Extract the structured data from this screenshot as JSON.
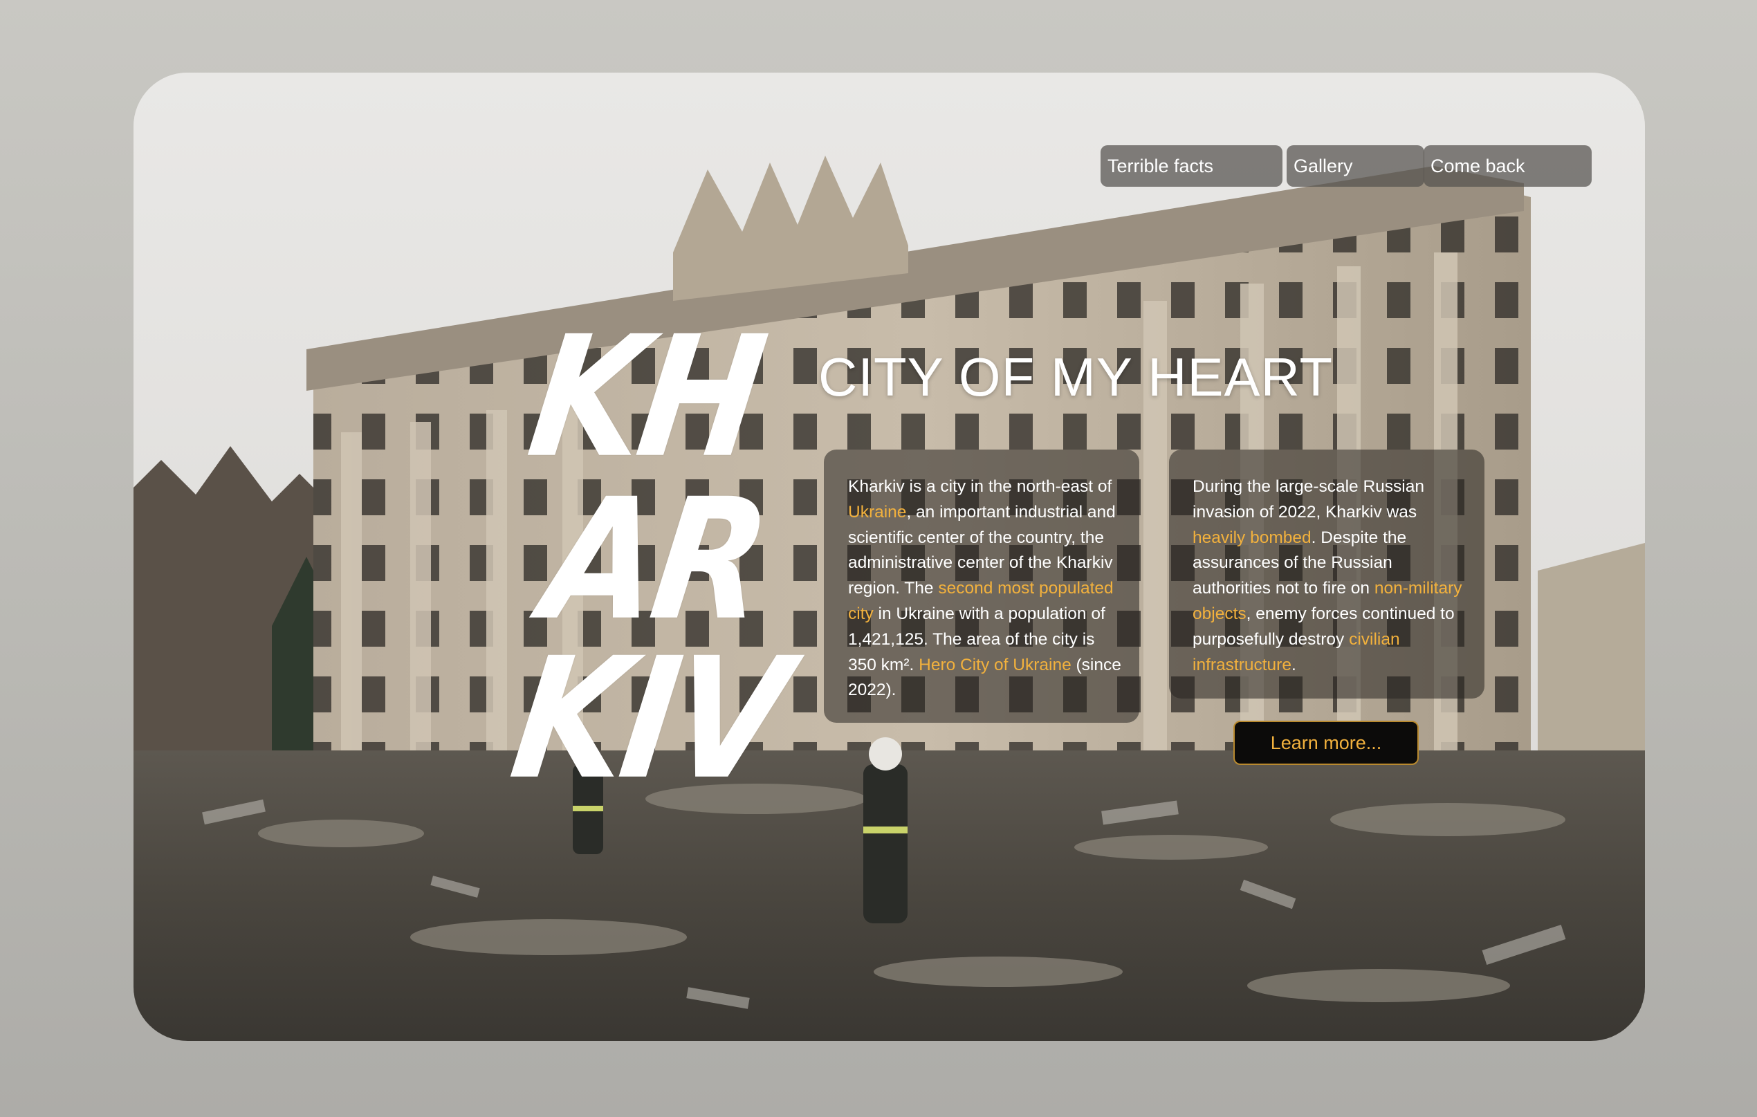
{
  "nav": {
    "items": [
      {
        "label": "Terrible facts"
      },
      {
        "label": "Gallery"
      },
      {
        "label": "Come back"
      }
    ]
  },
  "hero": {
    "name_lines": [
      "KH",
      "AR",
      "KIV"
    ],
    "title": "CITY OF MY HEART"
  },
  "panel_left": {
    "t1": "Kharkiv is a city in the north-east of ",
    "l1": "Ukraine",
    "t2": ", an important industrial and scientific center of the country, the administrative center of the Kharkiv region. The ",
    "l2": "second most populated city",
    "t3": " in Ukraine with a population of 1,421,125. The area of the city is 350 km². ",
    "l3": "Hero City of Ukraine",
    "t4": " (since 2022)."
  },
  "panel_right": {
    "t1": "During the large-scale Russian invasion of 2022, Kharkiv was ",
    "l1": "heavily bombed",
    "t2": ". Despite the assurances of the Russian authorities not to fire on ",
    "l2": "non-military objects",
    "t3": ", enemy forces continued to purposefully destroy ",
    "l3": "civilian infrastructure",
    "t4": "."
  },
  "cta": {
    "label": "Learn more..."
  },
  "colors": {
    "accent": "#f2b13d",
    "panel": "rgba(40,36,32,0.55)",
    "page_bg": "#c3c2bd"
  }
}
